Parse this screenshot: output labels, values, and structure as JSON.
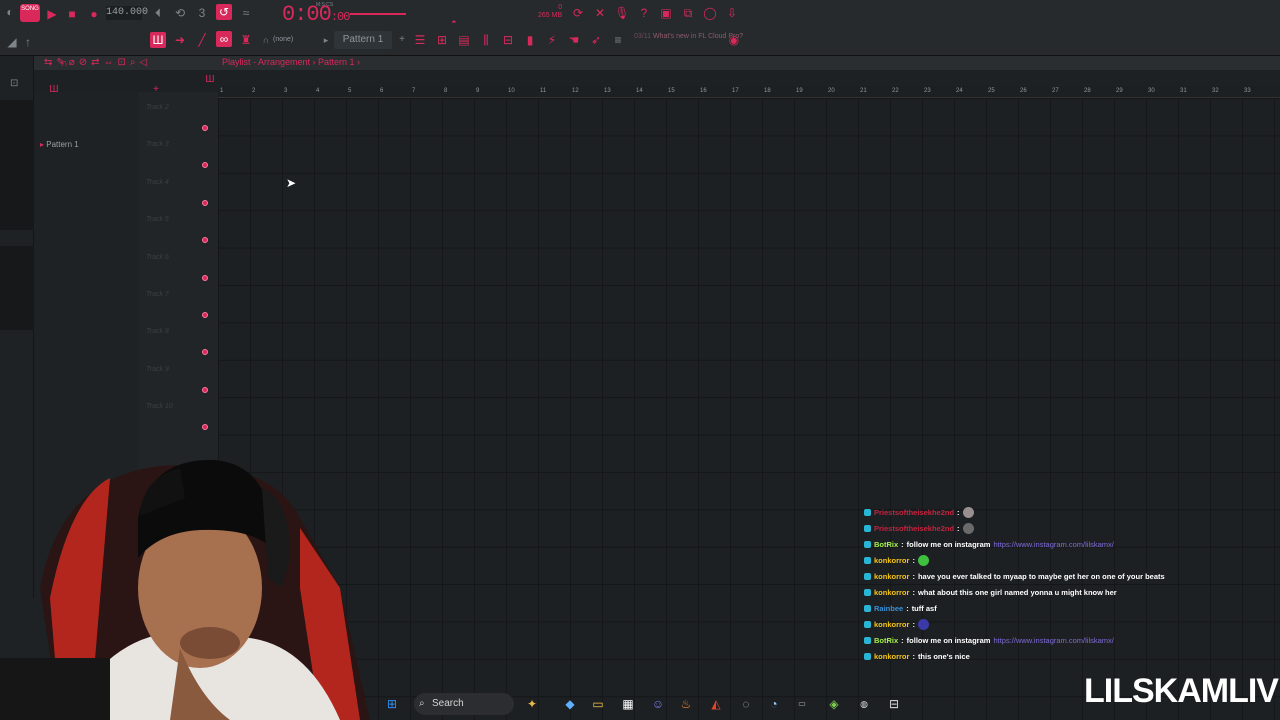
{
  "toolbar": {
    "song_badge": "SONG",
    "tempo": "140.000",
    "timecode": "0:00",
    "timecode_ms": "00",
    "timecode_sub": "M:S:CS",
    "memory": "265 MB",
    "cpu_value": "0",
    "pattern_selector": "Pattern 1",
    "snap_value": "(none)",
    "news_date": "03/11",
    "news_text": "What's new in FL Cloud Pro?"
  },
  "playlist": {
    "breadcrumb": "Playlist - Arrangement › Pattern 1 ›",
    "pattern_item": "Pattern 1",
    "tracks": [
      "Track 2",
      "Track 3",
      "Track 4",
      "Track 5",
      "Track 6",
      "Track 7",
      "Track 8",
      "Track 9",
      "Track 10"
    ],
    "ruler_numbers": [
      "1",
      "2",
      "3",
      "4",
      "5",
      "6",
      "7",
      "8",
      "9",
      "10",
      "11",
      "12",
      "13",
      "14",
      "15",
      "16",
      "17",
      "18",
      "19",
      "20",
      "21",
      "22",
      "23",
      "24",
      "25",
      "26",
      "27",
      "28",
      "29",
      "30",
      "31",
      "32",
      "33"
    ]
  },
  "chat": {
    "messages": [
      {
        "user": "Priestsoftheisekhe2nd",
        "text": "",
        "user_color": "#c1233f",
        "emote_color": "#9a8f8f"
      },
      {
        "user": "Priestsoftheisekhe2nd",
        "text": "",
        "user_color": "#c1233f",
        "emote_color": "#6a6a6a"
      },
      {
        "user": "BotRix",
        "text": "follow me on instagram",
        "link": "https://www.instagram.com/lilskamx/",
        "user_color": "#a6f04a"
      },
      {
        "user": "konkorror",
        "text": "",
        "user_color": "#f5c518",
        "emote_color": "#3fbf3f"
      },
      {
        "user": "konkorror",
        "text": "have you ever talked to myaap to maybe get her on one of your beats",
        "user_color": "#f5c518"
      },
      {
        "user": "konkorror",
        "text": "what about this one girl named yonna u might know her",
        "user_color": "#f5c518"
      },
      {
        "user": "Rainbee",
        "text": "tuff asf",
        "user_color": "#3a8fd8"
      },
      {
        "user": "konkorror",
        "text": "",
        "user_color": "#f5c518",
        "emote_color": "#3a3aa8"
      },
      {
        "user": "BotRix",
        "text": "follow me on instagram",
        "link": "https://www.instagram.com/lilskamx/",
        "user_color": "#a6f04a"
      },
      {
        "user": "konkorror",
        "text": "this one's nice",
        "user_color": "#f5c518"
      }
    ]
  },
  "taskbar": {
    "search_label": "Search"
  },
  "brand": "LILSKAMLIVE",
  "colors": {
    "accent": "#d8295a",
    "background": "#1d2023"
  }
}
